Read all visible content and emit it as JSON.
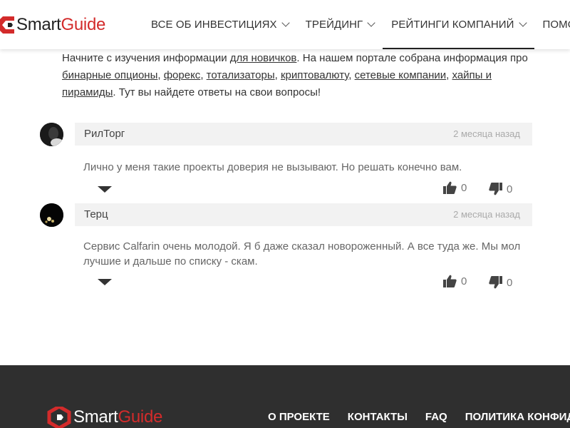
{
  "header": {
    "logo": {
      "smart": "Smart",
      "guide": "Guide"
    },
    "nav": [
      {
        "label": "ВСЕ ОБ ИНВЕСТИЦИЯХ",
        "has_dropdown": true,
        "active": false
      },
      {
        "label": "ТРЕЙДИНГ",
        "has_dropdown": true,
        "active": false
      },
      {
        "label": "РЕЙТИНГИ КОМПАНИЙ",
        "has_dropdown": true,
        "active": true
      },
      {
        "label": "ПОМО",
        "has_dropdown": false,
        "active": false
      }
    ]
  },
  "intro": {
    "t1": "Начните с изучения информации ",
    "link_beginners": "для новичков",
    "t2": ". На нашем портале собрана информация про ",
    "link_binary": "бинарные опционы",
    "t3": ", ",
    "link_forex": "форекс",
    "t4": ", ",
    "link_totalizators": "тотализаторы",
    "t5": ", ",
    "link_crypto": "криптовалюту",
    "t6": ", ",
    "link_network": "сетевые компании",
    "t7": ", ",
    "link_hype": "хайпы и пирамиды",
    "t8": ". Тут вы найдете ответы на свои вопросы!"
  },
  "comments": [
    {
      "author": "РилТорг",
      "date": "2 месяца назад",
      "text": "Лично у меня такие проекты доверия не вызывают. Но решать конечно вам.",
      "likes": "0",
      "dislikes": "0"
    },
    {
      "author": "Терц",
      "date": "2 месяца назад",
      "text": "Сервис Calfarin очень молодой. Я б даже сказал новороженный. А все туда же. Мы мол лучшие и дальше по списку - скам.",
      "likes": "0",
      "dislikes": "0"
    }
  ],
  "footer": {
    "logo": {
      "smart": "Smart",
      "guide": "Guide"
    },
    "nav": [
      "О ПРОЕКТЕ",
      "КОНТАКТЫ",
      "FAQ",
      "ПОЛИТИКА КОНФИД"
    ]
  },
  "colors": {
    "brand_red": "#d32b2b",
    "footer_bg": "#2f2f2f",
    "comment_head_bg": "#f2f2f2"
  }
}
